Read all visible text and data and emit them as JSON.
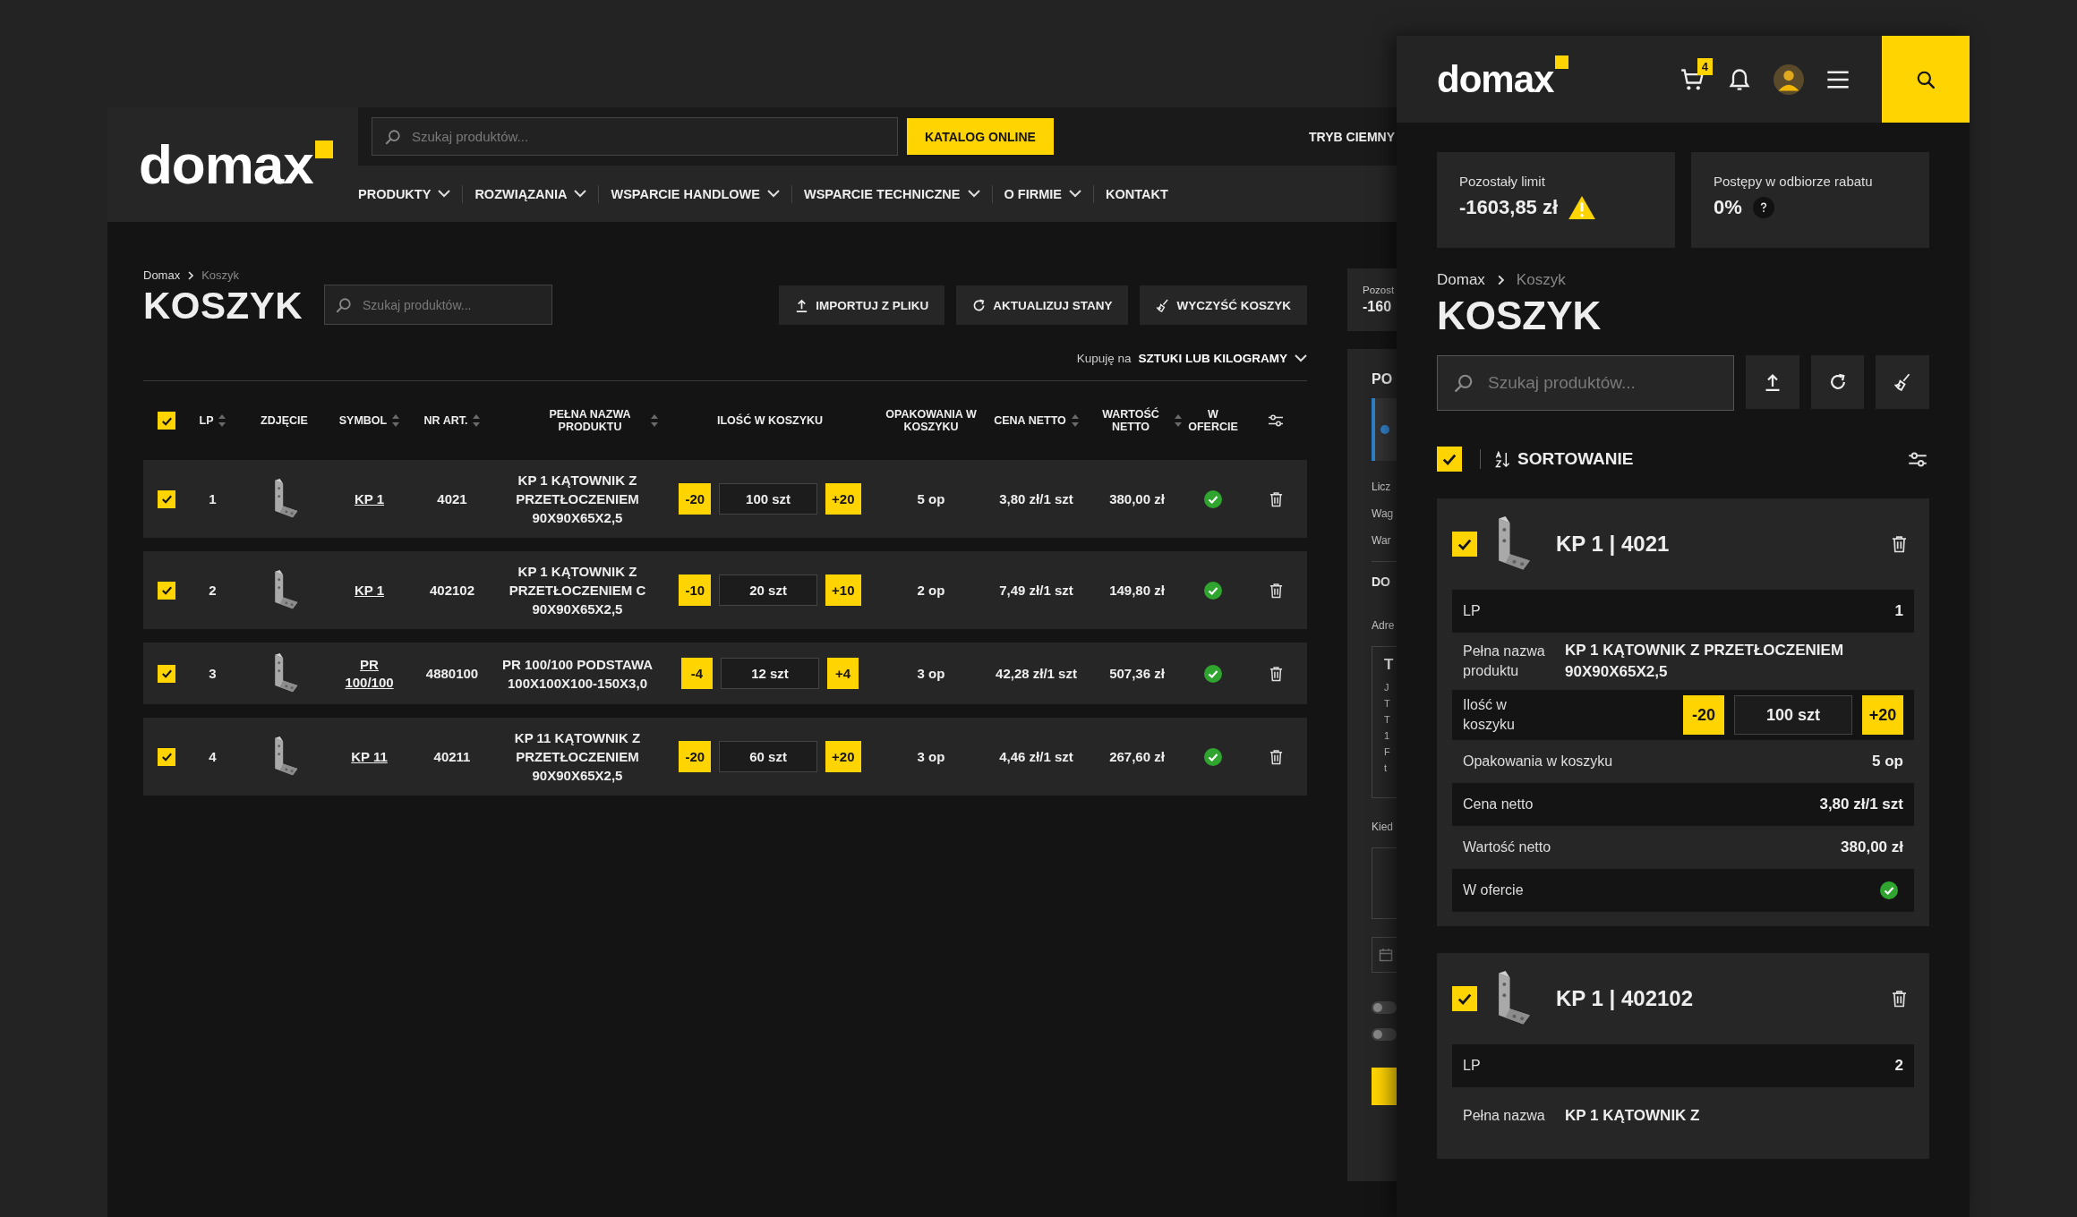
{
  "desktop": {
    "logo": "domax",
    "search": {
      "placeholder": "Szukaj produktów..."
    },
    "catalog_button": "KATALOG ONLINE",
    "dark_mode": "TRYB CIEMNY",
    "nav": [
      {
        "label": "PRODUKTY",
        "dropdown": true
      },
      {
        "label": "ROZWIĄZANIA",
        "dropdown": true
      },
      {
        "label": "WSPARCIE HANDLOWE",
        "dropdown": true
      },
      {
        "label": "WSPARCIE TECHNICZNE",
        "dropdown": true
      },
      {
        "label": "O FIRMIE",
        "dropdown": true
      },
      {
        "label": "KONTAKT",
        "dropdown": false
      }
    ],
    "breadcrumb": [
      "Domax",
      "Koszyk"
    ],
    "title": "KOSZYK",
    "cart_search": {
      "placeholder": "Szukaj produktów..."
    },
    "actions": [
      {
        "label": "IMPORTUJ Z PLIKU",
        "kind": "upload"
      },
      {
        "label": "AKTUALIZUJ STANY",
        "kind": "refresh"
      },
      {
        "label": "WYCZYŚĆ KOSZYK",
        "kind": "broom"
      }
    ],
    "unit_selector": {
      "label": "Kupuję na",
      "value": "SZTUKI LUB KILOGRAMY"
    },
    "table": {
      "all_checked": true,
      "columns": [
        {
          "label": "LP",
          "sortable": true
        },
        {
          "label": "ZDJĘCIE",
          "sortable": false
        },
        {
          "label": "SYMBOL",
          "sortable": true
        },
        {
          "label": "NR ART.",
          "sortable": true
        },
        {
          "label": "PEŁNA NAZWA PRODUKTU",
          "sortable": true
        },
        {
          "label": "ILOŚĆ W KOSZYKU",
          "sortable": false
        },
        {
          "label": "OPAKOWANIA W KOSZYKU",
          "sortable": false
        },
        {
          "label": "CENA NETTO",
          "sortable": true
        },
        {
          "label": "WARTOŚĆ NETTO",
          "sortable": true
        },
        {
          "label": "W OFERCIE",
          "sortable": false
        }
      ],
      "rows": [
        {
          "checked": true,
          "lp": "1",
          "symbol": "KP 1",
          "nr_art": "4021",
          "name": "KP 1 KĄTOWNIK Z PRZETŁOCZENIEM 90X90X65X2,5",
          "minus": "-20",
          "quantity": "100 szt",
          "plus": "+20",
          "packages": "5 op",
          "price": "3,80 zł/1 szt",
          "value": "380,00 zł",
          "in_offer": true
        },
        {
          "checked": true,
          "lp": "2",
          "symbol": "KP 1",
          "nr_art": "402102",
          "name": "KP 1 KĄTOWNIK Z PRZETŁOCZENIEM C 90X90X65X2,5",
          "minus": "-10",
          "quantity": "20 szt",
          "plus": "+10",
          "packages": "2 op",
          "price": "7,49 zł/1 szt",
          "value": "149,80 zł",
          "in_offer": true
        },
        {
          "checked": true,
          "lp": "3",
          "symbol": "PR 100/100",
          "nr_art": "4880100",
          "name": "PR 100/100 PODSTAWA 100X100X100-150X3,0",
          "minus": "-4",
          "quantity": "12 szt",
          "plus": "+4",
          "packages": "3 op",
          "price": "42,28 zł/1 szt",
          "value": "507,36 zł",
          "in_offer": true
        },
        {
          "checked": true,
          "lp": "4",
          "symbol": "KP 11",
          "nr_art": "40211",
          "name": "KP 11 KĄTOWNIK Z PRZETŁOCZENIEM 90X90X65X2,5",
          "minus": "-20",
          "quantity": "60 szt",
          "plus": "+20",
          "packages": "3 op",
          "price": "4,46 zł/1 szt",
          "value": "267,60 zł",
          "in_offer": true
        }
      ]
    },
    "side_panel": {
      "limit_label": "Pozost",
      "limit_value": "-160",
      "title": "PO",
      "stats": [
        "Licz",
        "Wag",
        "War"
      ],
      "delivery_title": "DO",
      "address_label": "Adre",
      "address_title": "T",
      "address_lines": [
        "J",
        "T",
        "T",
        "1",
        "F",
        "t"
      ],
      "when_label": "Kied",
      "toggles": [
        {
          "on": false
        },
        {
          "on": false
        }
      ]
    }
  },
  "mobile": {
    "logo": "domax",
    "cart_count": "4",
    "stats": [
      {
        "label": "Pozostały limit",
        "value": "-1603,85 zł",
        "kind": "warning"
      },
      {
        "label": "Postępy w odbiorze rabatu",
        "value": "0%",
        "kind": "help"
      }
    ],
    "breadcrumb": [
      "Domax",
      "Koszyk"
    ],
    "title": "KOSZYK",
    "search": {
      "placeholder": "Szukaj produktów..."
    },
    "all_checked": true,
    "sort_label": "SORTOWANIE",
    "cards": [
      {
        "checked": true,
        "heading": "KP 1 | 4021",
        "fields": [
          {
            "kind": "text",
            "label": "LP",
            "value": "1"
          },
          {
            "kind": "name",
            "label": "Pełna nazwa produktu",
            "value": "KP 1 KĄTOWNIK Z PRZETŁOCZENIEM 90X90X65X2,5"
          },
          {
            "kind": "quantity",
            "label": "Ilość w koszyku",
            "minus": "-20",
            "value": "100 szt",
            "plus": "+20"
          },
          {
            "kind": "text",
            "label": "Opakowania w koszyku",
            "value": "5 op"
          },
          {
            "kind": "text",
            "label": "Cena netto",
            "value": "3,80 zł/1 szt"
          },
          {
            "kind": "text",
            "label": "Wartość netto",
            "value": "380,00 zł"
          },
          {
            "kind": "check",
            "label": "W ofercie",
            "in_offer": true
          }
        ]
      },
      {
        "checked": true,
        "heading": "KP 1 | 402102",
        "fields": [
          {
            "kind": "text",
            "label": "LP",
            "value": "2"
          },
          {
            "kind": "name",
            "label": "Pełna nazwa",
            "value": "KP 1 KĄTOWNIK Z"
          }
        ]
      }
    ]
  }
}
